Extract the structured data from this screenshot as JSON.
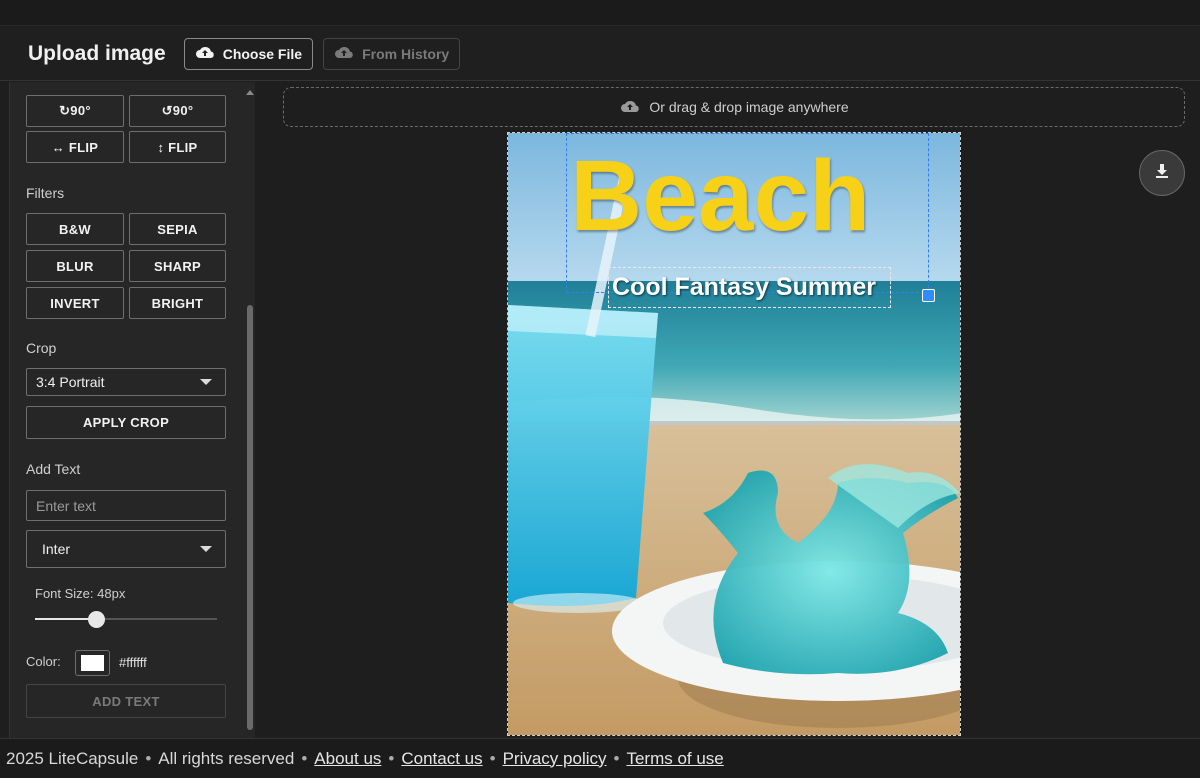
{
  "header": {
    "title": "Upload image",
    "choose_file": "Choose File",
    "from_history": "From History"
  },
  "sidebar": {
    "rotate_cw": "↻90°",
    "rotate_ccw": "↺90°",
    "flip_h": "↔ FLIP",
    "flip_v": "↕ FLIP",
    "filters_label": "Filters",
    "filters": [
      "B&W",
      "SEPIA",
      "BLUR",
      "SHARP",
      "INVERT",
      "BRIGHT"
    ],
    "crop_label": "Crop",
    "crop_selected": "3:4 Portrait",
    "apply_crop": "APPLY CROP",
    "add_text_label": "Add Text",
    "text_placeholder": "Enter text",
    "font_selected": "Inter",
    "font_size_label": "Font Size: 48px",
    "font_size_value": 48,
    "color_label": "Color:",
    "color_value": "#ffffff",
    "add_text_button": "ADD TEXT"
  },
  "main": {
    "dropzone_text": "Or drag & drop image anywhere",
    "overlay_title": "Beach",
    "overlay_subtitle": "Cool Fantasy Summer",
    "overlay_title_color": "#f7d117",
    "overlay_subtitle_color": "#ffffff"
  },
  "footer": {
    "copyright": "2025 LiteCapsule",
    "rights": "All rights reserved",
    "links": [
      "About us",
      "Contact us",
      "Privacy policy",
      "Terms of use"
    ]
  }
}
